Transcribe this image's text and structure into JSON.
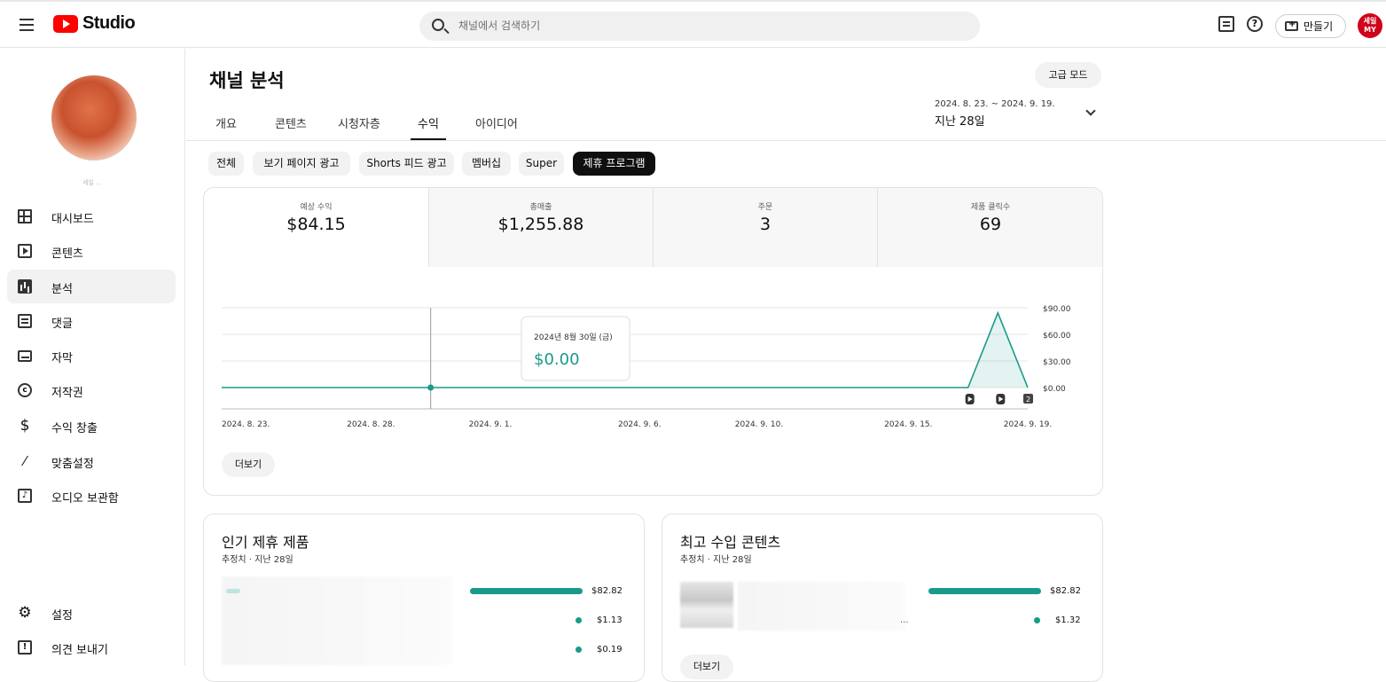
{
  "header": {
    "logo_text": "Studio",
    "search_placeholder": "채널에서 검색하기",
    "create_label": "만들기",
    "avatar_text": "세일 MY"
  },
  "sidebar": {
    "channel_name": "세일 ...",
    "items": [
      {
        "label": "대시보드",
        "icon": "dashboard-icon"
      },
      {
        "label": "콘텐츠",
        "icon": "content-icon"
      },
      {
        "label": "분석",
        "icon": "analytics-icon"
      },
      {
        "label": "댓글",
        "icon": "comments-icon"
      },
      {
        "label": "자막",
        "icon": "subtitles-icon"
      },
      {
        "label": "저작권",
        "icon": "copyright-icon"
      },
      {
        "label": "수익 창출",
        "icon": "dollar-icon"
      },
      {
        "label": "맞춤설정",
        "icon": "wand-icon"
      },
      {
        "label": "오디오 보관함",
        "icon": "audio-library-icon"
      }
    ],
    "bottom_items": [
      {
        "label": "설정",
        "icon": "gear-icon"
      },
      {
        "label": "의견 보내기",
        "icon": "feedback-icon"
      }
    ]
  },
  "main": {
    "title": "채널 분석",
    "advanced_mode": "고급 모드",
    "tabs": [
      "개요",
      "콘텐츠",
      "시청자층",
      "수익",
      "아이디어"
    ],
    "active_tab": "수익",
    "date_range": "2024. 8. 23. ~ 2024. 9. 19.",
    "date_label": "지난 28일",
    "chips": [
      "전체",
      "보기 페이지 광고",
      "Shorts 피드 광고",
      "멤버십",
      "Super",
      "제휴 프로그램"
    ],
    "active_chip": "제휴 프로그램",
    "metrics": [
      {
        "label": "예상 수익",
        "value": "$84.15"
      },
      {
        "label": "총매출",
        "value": "$1,255.88"
      },
      {
        "label": "주문",
        "value": "3"
      },
      {
        "label": "제품 클릭수",
        "value": "69"
      }
    ],
    "tooltip": {
      "date": "2024년 8월 30일 (금)",
      "value": "$0.00"
    },
    "more_label": "더보기",
    "top_products": {
      "title": "인기 제휴 제품",
      "subtitle": "추정치 · 지난 28일",
      "values": [
        "$82.82",
        "$1.13",
        "$0.19"
      ]
    },
    "top_content": {
      "title": "최고 수입 콘텐츠",
      "subtitle": "추정치 · 지난 28일",
      "values": [
        "$82.82",
        "$1.32"
      ],
      "ellipsis": "...",
      "more_label": "더보기"
    }
  },
  "chart_data": {
    "type": "area",
    "x": [
      "2024. 8. 23.",
      "2024. 8. 28.",
      "2024. 9. 1.",
      "2024. 9. 6.",
      "2024. 9. 10.",
      "2024. 9. 15.",
      "2024. 9. 19."
    ],
    "x_ticks": [
      "2024. 8. 23.",
      "2024. 8. 28.",
      "2024. 9. 1.",
      "2024. 9. 6.",
      "2024. 9. 10.",
      "2024. 9. 15.",
      "2024. 9. 19."
    ],
    "series": [
      {
        "values": [
          0,
          0,
          0,
          0,
          0,
          0,
          0,
          0,
          0,
          0,
          0,
          0,
          0,
          0,
          0,
          0,
          0,
          0,
          0,
          0,
          0,
          0,
          0,
          0,
          0,
          0,
          84.15,
          0
        ]
      }
    ],
    "start_day_label": "2024. 8. 23.",
    "y_ticks": [
      "$90.00",
      "$60.00",
      "$30.00",
      "$0.00"
    ],
    "ylim": [
      0,
      90
    ],
    "grid": true,
    "color": "#1a9a8a",
    "markers": [
      {
        "type": "shorts-icon"
      },
      {
        "type": "shorts-icon"
      },
      {
        "type": "count-badge",
        "text": "2"
      }
    ]
  }
}
